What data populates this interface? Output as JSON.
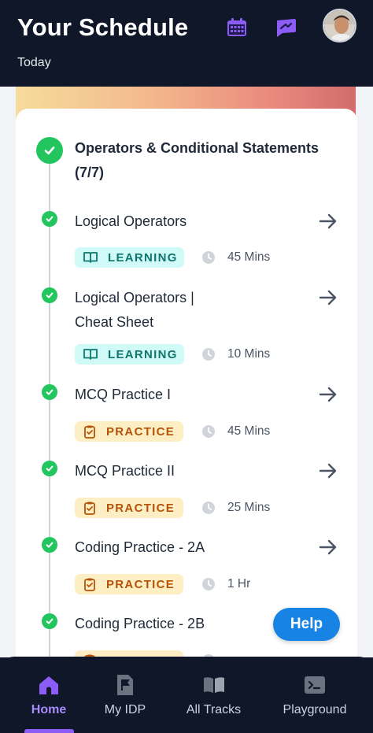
{
  "header": {
    "title": "Your Schedule",
    "subtitle": "Today",
    "icons": [
      "calendar-icon",
      "message-icon"
    ],
    "accent_color": "#8b5cf6"
  },
  "module": {
    "title": "Operators & Conditional Statements (7/7)",
    "status": "completed"
  },
  "items": [
    {
      "title": "Logical Operators",
      "type": "LEARNING",
      "duration": "45 Mins"
    },
    {
      "title": "Logical Operators | Cheat Sheet",
      "type": "LEARNING",
      "duration": "10 Mins"
    },
    {
      "title": "MCQ Practice I",
      "type": "PRACTICE",
      "duration": "45 Mins"
    },
    {
      "title": "MCQ Practice II",
      "type": "PRACTICE",
      "duration": "25 Mins"
    },
    {
      "title": "Coding Practice - 2A",
      "type": "PRACTICE",
      "duration": "1 Hr"
    },
    {
      "title": "Coding Practice - 2B",
      "type": "PRACTICE",
      "duration": ""
    }
  ],
  "help": {
    "label": "Help"
  },
  "nav": {
    "items": [
      {
        "label": "Home",
        "icon": "home-icon",
        "active": true
      },
      {
        "label": "My IDP",
        "icon": "idp-flag-icon",
        "active": false
      },
      {
        "label": "All Tracks",
        "icon": "book-open-icon",
        "active": false
      },
      {
        "label": "Playground",
        "icon": "terminal-icon",
        "active": false
      }
    ]
  },
  "colors": {
    "success": "#22c55e",
    "learning_bg": "#cffaf7",
    "learning_text": "#0f766e",
    "practice_bg": "#fdefc3",
    "practice_text": "#b45309",
    "help": "#1683e5"
  }
}
